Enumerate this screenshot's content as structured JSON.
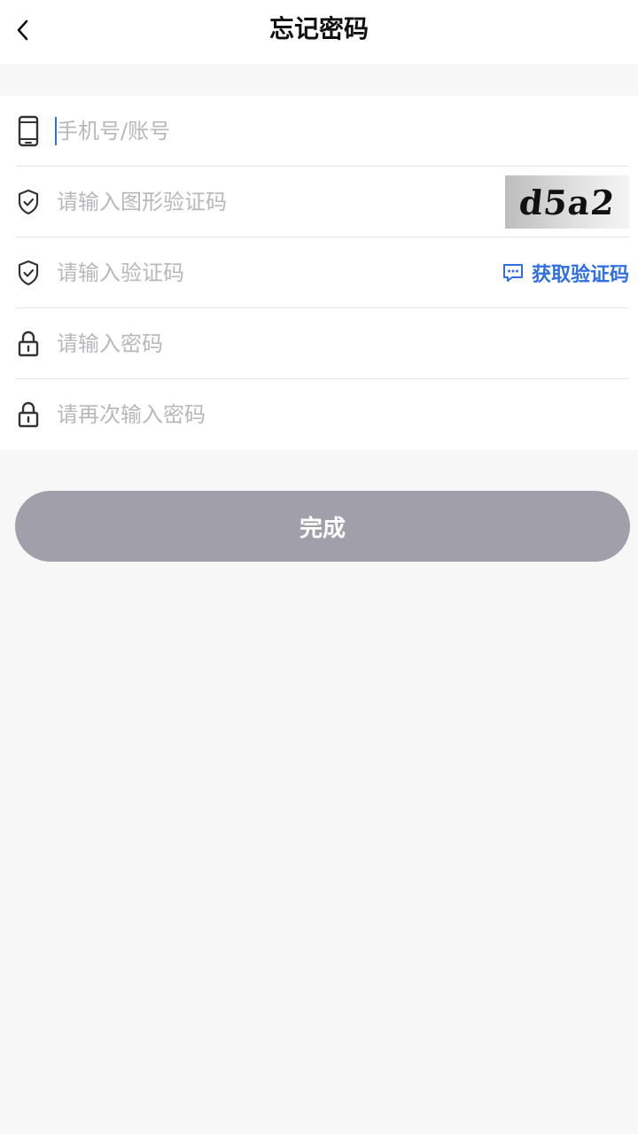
{
  "header": {
    "title": "忘记密码",
    "back_icon": "chevron-left-icon"
  },
  "form": {
    "account": {
      "icon": "phone-icon",
      "placeholder": "手机号/账号",
      "value": ""
    },
    "image_captcha": {
      "icon": "shield-check-icon",
      "placeholder": "请输入图形验证码",
      "value": "",
      "captcha_text": "d5a2"
    },
    "sms_code": {
      "icon": "shield-check-icon",
      "placeholder": "请输入验证码",
      "value": "",
      "get_code_label": "获取验证码",
      "get_code_icon": "message-icon"
    },
    "password": {
      "icon": "lock-icon",
      "placeholder": "请输入密码",
      "value": ""
    },
    "confirm_password": {
      "icon": "lock-icon",
      "placeholder": "请再次输入密码",
      "value": ""
    }
  },
  "submit": {
    "label": "完成"
  },
  "colors": {
    "accent": "#2f6fe3",
    "button_disabled": "#a1a0aa",
    "placeholder": "#b8b8bc",
    "background": "#f7f7f7"
  }
}
